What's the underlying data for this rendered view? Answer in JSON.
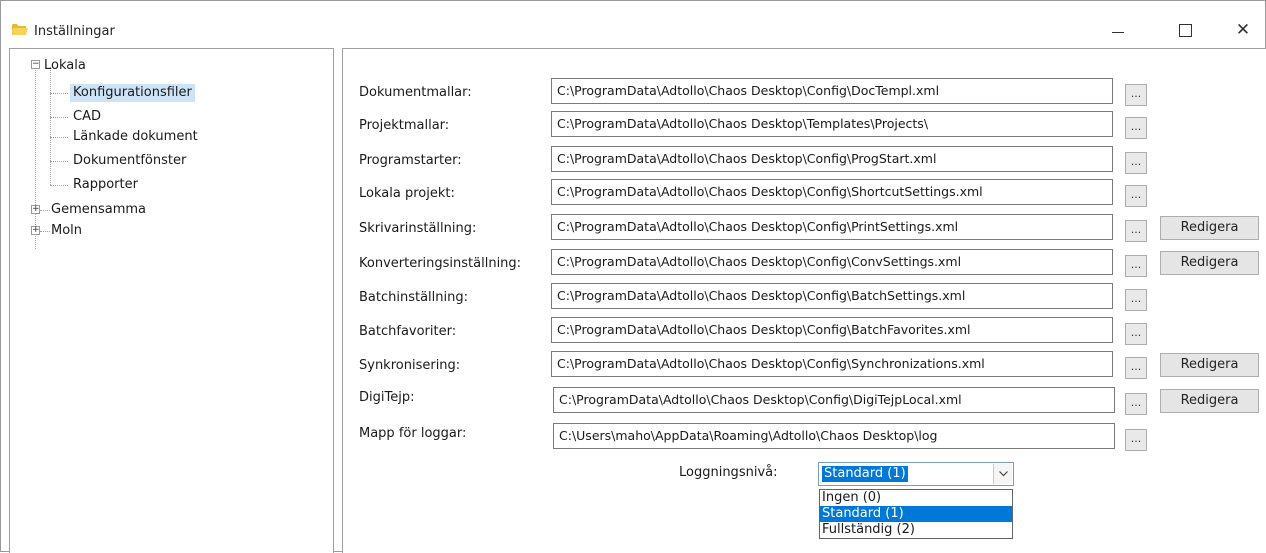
{
  "window": {
    "title": "Inställningar",
    "colors": {
      "tree_selected": "#cde4f7",
      "select_highlight": "#0078d7"
    }
  },
  "tree": {
    "root_local": "Lokala",
    "local_children": [
      "Konfigurationsfiler",
      "CAD",
      "Länkade dokument",
      "Dokumentfönster",
      "Rapporter"
    ],
    "shared": "Gemensamma",
    "cloud": "Moln",
    "expanded_symbol": "−",
    "collapsed_symbol": "+"
  },
  "config": {
    "browse_label": "...",
    "edit_label": "Redigera",
    "rows": [
      {
        "label": "Dokumentmallar:",
        "value": "C:\\ProgramData\\Adtollo\\Chaos Desktop\\Config\\DocTempl.xml"
      },
      {
        "label": "Projektmallar:",
        "value": "C:\\ProgramData\\Adtollo\\Chaos Desktop\\Templates\\Projects\\"
      },
      {
        "label": "Programstarter:",
        "value": "C:\\ProgramData\\Adtollo\\Chaos Desktop\\Config\\ProgStart.xml"
      },
      {
        "label": "Lokala projekt:",
        "value": "C:\\ProgramData\\Adtollo\\Chaos Desktop\\Config\\ShortcutSettings.xml"
      },
      {
        "label": "Skrivarinställning:",
        "value": "C:\\ProgramData\\Adtollo\\Chaos Desktop\\Config\\PrintSettings.xml"
      },
      {
        "label": "Konverteringsinställning:",
        "value": "C:\\ProgramData\\Adtollo\\Chaos Desktop\\Config\\ConvSettings.xml"
      },
      {
        "label": "Batchinställning:",
        "value": "C:\\ProgramData\\Adtollo\\Chaos Desktop\\Config\\BatchSettings.xml"
      },
      {
        "label": "Batchfavoriter:",
        "value": "C:\\ProgramData\\Adtollo\\Chaos Desktop\\Config\\BatchFavorites.xml"
      },
      {
        "label": "Synkronisering:",
        "value": "C:\\ProgramData\\Adtollo\\Chaos Desktop\\Config\\Synchronizations.xml"
      },
      {
        "label": "DigiTejp:",
        "value": "C:\\ProgramData\\Adtollo\\Chaos Desktop\\Config\\DigiTejpLocal.xml"
      },
      {
        "label": "Mapp för loggar:",
        "value": "C:\\Users\\maho\\AppData\\Roaming\\Adtollo\\Chaos Desktop\\log"
      }
    ]
  },
  "logging": {
    "label": "Loggningsnivå:",
    "selected": "Standard (1)",
    "options": [
      "Ingen (0)",
      "Standard (1)",
      "Fullständig (2)"
    ]
  }
}
